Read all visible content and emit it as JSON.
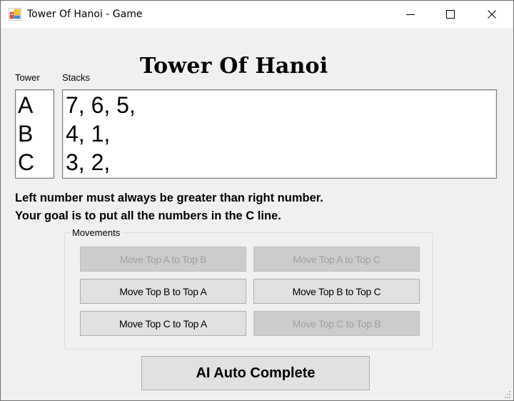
{
  "window": {
    "title": "Tower Of Hanoi - Game",
    "app_icon": "windows-form-icon",
    "controls": {
      "minimize_icon": "minimize-icon",
      "maximize_icon": "maximize-icon",
      "close_icon": "close-icon"
    }
  },
  "header": {
    "title": "Tower Of Hanoi"
  },
  "labels": {
    "tower": "Tower",
    "stacks": "Stacks"
  },
  "towers": [
    {
      "name": "A",
      "stack": "7, 6, 5,"
    },
    {
      "name": "B",
      "stack": "4, 1,"
    },
    {
      "name": "C",
      "stack": "3, 2,"
    }
  ],
  "instructions": {
    "line1": "Left number must always be greater than right number.",
    "line2": "Your goal is to put all the numbers in the C line."
  },
  "movements": {
    "legend": "Movements",
    "buttons": [
      {
        "label": "Move Top A to Top B",
        "enabled": false
      },
      {
        "label": "Move Top A to Top C",
        "enabled": false
      },
      {
        "label": "Move Top B to Top A",
        "enabled": true
      },
      {
        "label": "Move Top B to Top C",
        "enabled": true
      },
      {
        "label": "Move Top C to Top A",
        "enabled": true
      },
      {
        "label": "Move Top C to Top B",
        "enabled": false
      }
    ]
  },
  "ai_button": {
    "label": "AI Auto Complete"
  },
  "colors": {
    "window_bg": "#f0f0f0",
    "button_bg": "#e1e1e1",
    "button_disabled_bg": "#cccccc",
    "button_disabled_text": "#a0a0a0",
    "textbox_bg": "#ffffff"
  }
}
